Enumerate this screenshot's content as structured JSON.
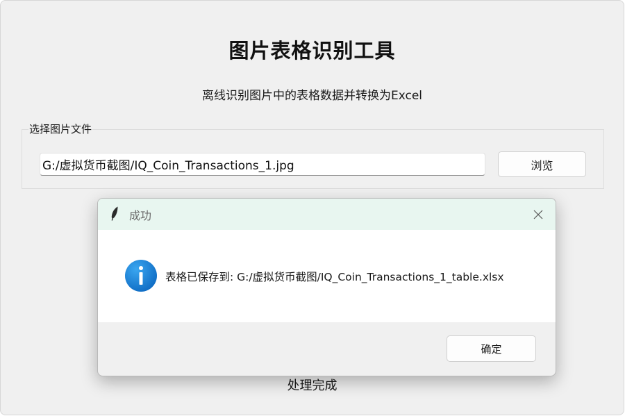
{
  "app": {
    "title": "图片表格识别工具",
    "subtitle": "离线识别图片中的表格数据并转换为Excel",
    "status": "处理完成"
  },
  "file_select": {
    "legend": "选择图片文件",
    "path": "G:/虚拟货币截图/IQ_Coin_Transactions_1.jpg",
    "browse_label": "浏览"
  },
  "dialog": {
    "title": "成功",
    "message": "表格已保存到: G:/虚拟货币截图/IQ_Coin_Transactions_1_table.xlsx",
    "ok_label": "确定",
    "icons": {
      "title_icon": "feather-icon",
      "message_icon": "info-icon",
      "close_icon": "close-icon"
    }
  },
  "colors": {
    "window_bg": "#f0f0f0",
    "dialog_titlebar_bg": "#e8f6f0",
    "info_icon": "#1a86d8"
  }
}
